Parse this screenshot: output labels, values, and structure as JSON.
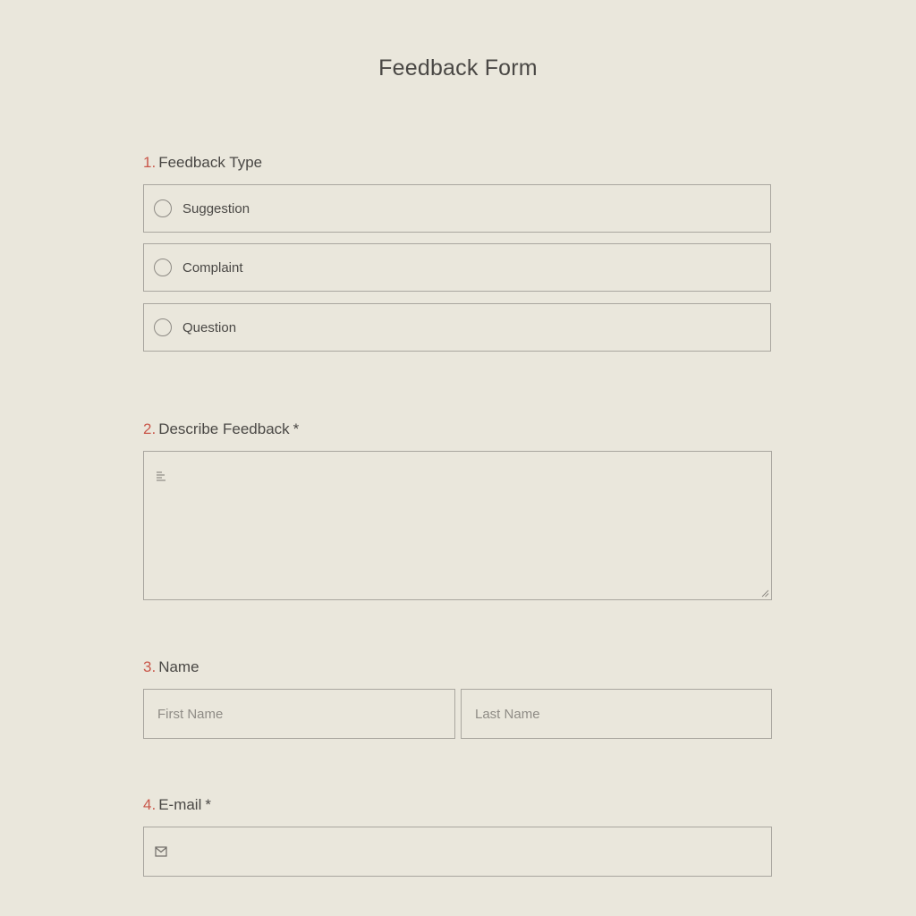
{
  "form": {
    "title": "Feedback Form"
  },
  "questions": {
    "q1": {
      "number": "1.",
      "label": "Feedback Type",
      "options": [
        "Suggestion",
        "Complaint",
        "Question"
      ]
    },
    "q2": {
      "number": "2.",
      "label": "Describe Feedback",
      "required_mark": "*",
      "value": ""
    },
    "q3": {
      "number": "3.",
      "label": "Name",
      "first_placeholder": "First Name",
      "last_placeholder": "Last Name"
    },
    "q4": {
      "number": "4.",
      "label": "E-mail",
      "required_mark": "*",
      "value": ""
    }
  },
  "icons": {
    "textarea": "text-lines-icon",
    "email": "envelope-icon"
  },
  "colors": {
    "background": "#eae7dc",
    "number_accent": "#c9574a",
    "text": "#4a4845",
    "border": "#a9a69f"
  }
}
